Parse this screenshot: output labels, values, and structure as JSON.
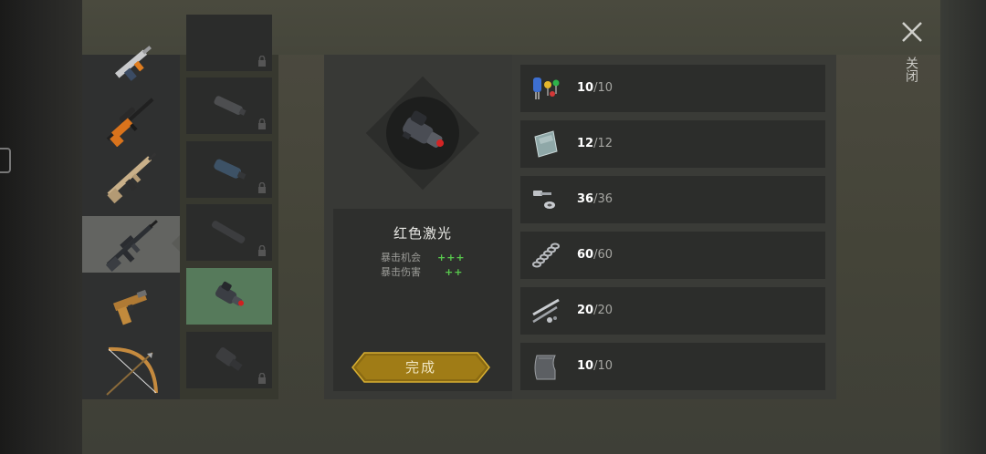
{
  "close": {
    "label": "关闭"
  },
  "weapons": [
    {
      "name": "smg-icon",
      "selected": false
    },
    {
      "name": "sniper-rifle-icon",
      "selected": false
    },
    {
      "name": "assault-rifle-tan-icon",
      "selected": false
    },
    {
      "name": "assault-rifle-icon",
      "selected": true
    },
    {
      "name": "pistol-icon",
      "selected": false
    },
    {
      "name": "bow-icon",
      "selected": false
    }
  ],
  "attachments": [
    {
      "name": "attachment-partial",
      "locked": true
    },
    {
      "name": "silencer-icon",
      "locked": true
    },
    {
      "name": "blue-silencer-icon",
      "locked": true
    },
    {
      "name": "long-silencer-icon",
      "locked": true
    },
    {
      "name": "red-laser-icon",
      "locked": false,
      "selected": true
    },
    {
      "name": "scope-mount-icon",
      "locked": true
    }
  ],
  "item": {
    "title": "红色激光",
    "stats": [
      {
        "label": "暴击机会",
        "value": "+++"
      },
      {
        "label": "暴击伤害",
        "value": "++"
      }
    ],
    "button": "完成"
  },
  "materials": [
    {
      "icon": "electronic-parts-icon",
      "have": "10",
      "need": "10"
    },
    {
      "icon": "glass-plate-icon",
      "have": "12",
      "need": "12"
    },
    {
      "icon": "bolts-nuts-icon",
      "have": "36",
      "need": "36"
    },
    {
      "icon": "spring-icon",
      "have": "60",
      "need": "60"
    },
    {
      "icon": "pipes-parts-icon",
      "have": "20",
      "need": "20"
    },
    {
      "icon": "metal-sheet-icon",
      "have": "10",
      "need": "10"
    }
  ],
  "colors": {
    "accent_gold": "#c9a227",
    "stat_green": "#59c94d",
    "selected_green": "#567a5b"
  }
}
